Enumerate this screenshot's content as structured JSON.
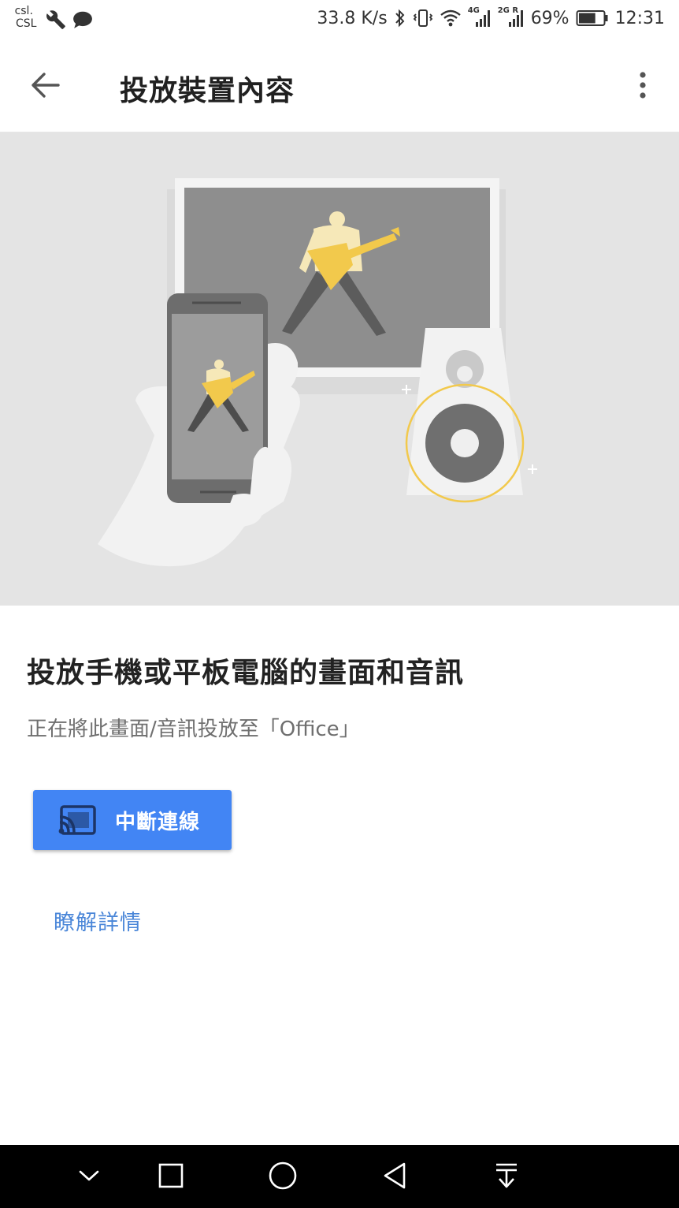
{
  "status_bar": {
    "carrier_line1": "csl.",
    "carrier_line2": "CSL",
    "left_icons": [
      "wrench-icon",
      "chat-bubble-icon"
    ],
    "net_speed": "33.8 K/s",
    "right_icons": [
      "bluetooth-icon",
      "vibrate-icon",
      "wifi-icon",
      "signal-4g-icon",
      "signal-2g-icon",
      "battery-icon"
    ],
    "signal_tag_1": "4G",
    "signal_tag_2": "2G R",
    "battery_percent": "69%",
    "battery_level": 0.69,
    "time": "12:31"
  },
  "app_bar": {
    "back_icon": "arrow-back-icon",
    "title": "投放裝置內容",
    "more_icon": "more-vert-icon"
  },
  "hero": {
    "illustration": "cast-illustration",
    "colors": {
      "background": "#e4e4e4",
      "accent_yellow": "#f2c94c",
      "screen_gray": "#8e8e8e"
    }
  },
  "main": {
    "heading": "投放手機或平板電腦的畫面和音訊",
    "subtext": "正在將此畫面/音訊投放至「Office」",
    "stop_button": {
      "label": "中斷連線",
      "icon": "cast-connected-icon",
      "color": "#4285f4"
    },
    "learn_more": "瞭解詳情"
  },
  "nav_bar": {
    "buttons": [
      "chevron-down-icon",
      "square-recents-icon",
      "circle-home-icon",
      "triangle-back-icon",
      "pull-down-icon"
    ]
  }
}
